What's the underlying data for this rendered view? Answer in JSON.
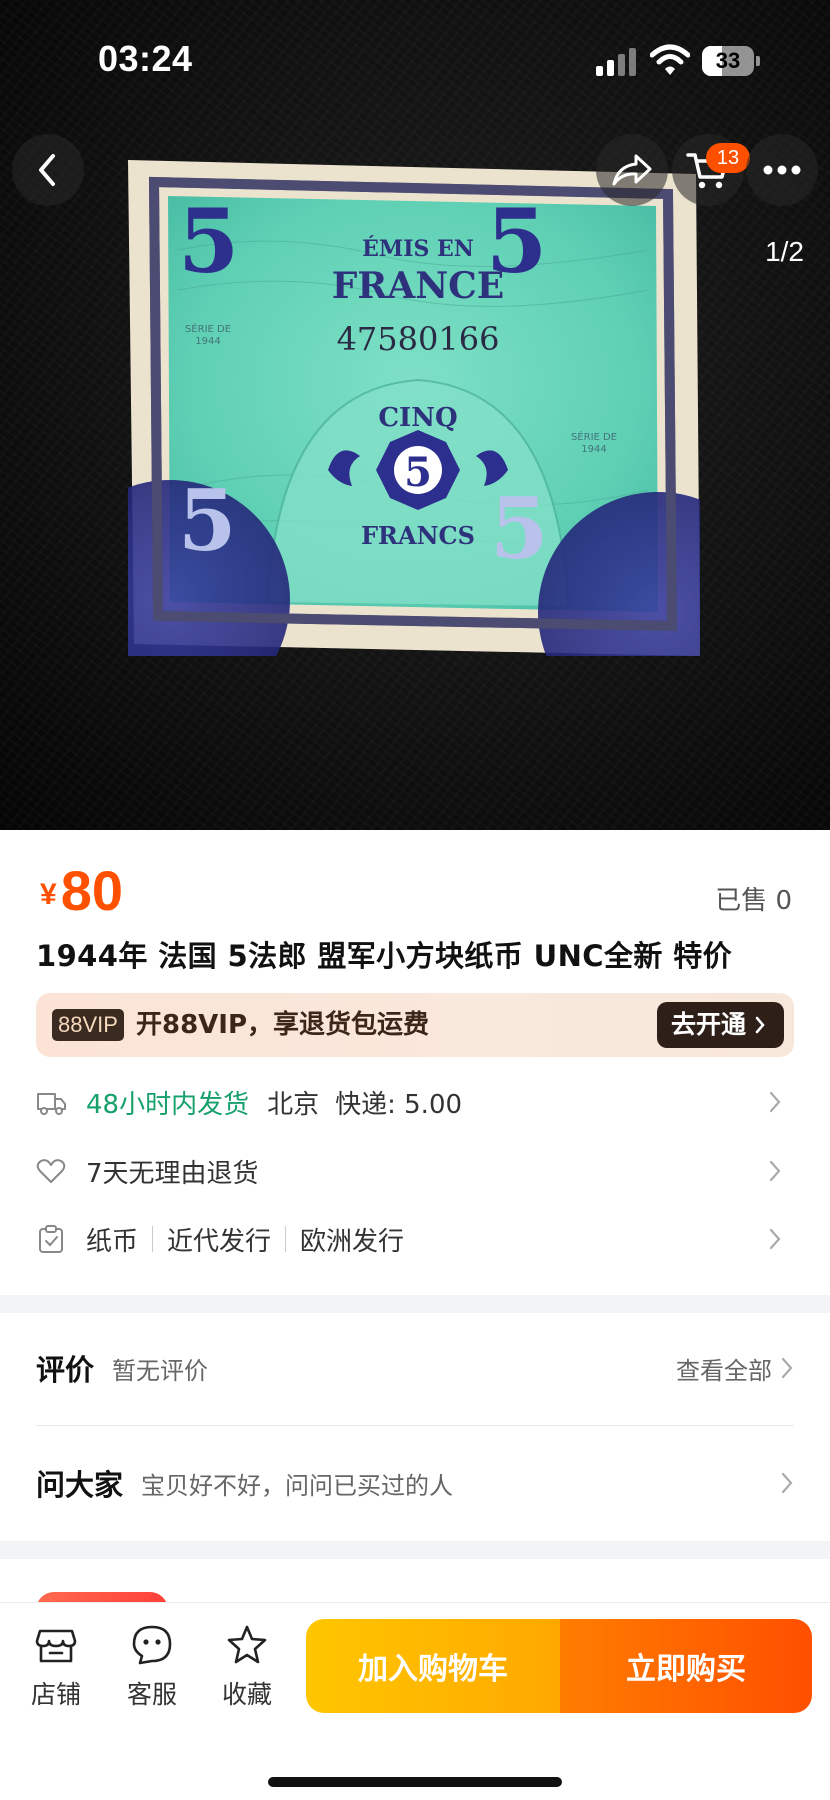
{
  "status_bar": {
    "time": "03:24",
    "battery": "33",
    "icons": [
      "cellular-signal-icon",
      "wifi-icon",
      "battery-icon"
    ]
  },
  "nav": {
    "icons": [
      "back-icon",
      "share-icon",
      "cart-icon",
      "more-icon"
    ],
    "cart_count": "13",
    "image_index": "1/2"
  },
  "banknote": {
    "header_line1": "ÉMIS EN",
    "header_line2": "FRANCE",
    "serial": "47580166",
    "denomination": "5",
    "word_value": "CINQ",
    "currency": "FRANCS",
    "series_label": "SÉRIE DE",
    "series_year": "1944"
  },
  "product": {
    "price_symbol": "¥",
    "price": "80",
    "sold": "已售 0",
    "title": "1944年 法国 5法郎 盟军小方块纸币 UNC全新 特价"
  },
  "vip": {
    "tag": "88VIP",
    "text": "开88VIP，享退货包运费",
    "button": "去开通"
  },
  "shipping": {
    "time": "48小时内发货",
    "city": "北京",
    "fee": "快递: 5.00"
  },
  "returns": {
    "text": "7天无理由退货"
  },
  "categories": [
    "纸币",
    "近代发行",
    "欧洲发行"
  ],
  "reviews": {
    "title": "评价",
    "subtitle": "暂无评价",
    "view_all": "查看全部"
  },
  "ask": {
    "title": "问大家",
    "subtitle": "宝贝好不好，问问已买过的人"
  },
  "bottom_bar": {
    "shop": "店铺",
    "service": "客服",
    "favorite": "收藏",
    "add_to_cart": "加入购物车",
    "buy_now": "立即购买"
  },
  "colors": {
    "accent": "#ff5000",
    "shipping_green": "#16a06a",
    "cart_button": "#ffb400",
    "buy_button": "#ff6000",
    "vip_dark": "#2e2018"
  }
}
